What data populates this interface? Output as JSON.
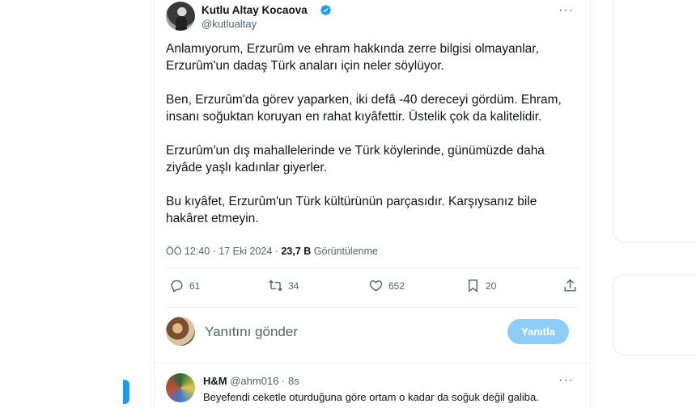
{
  "tweet": {
    "author_name": "Kutlu Altay Kocaova",
    "author_handle": "@kutlualtay",
    "more_label": "···",
    "paragraphs": [
      "Anlamıyorum, Erzurûm ve ehram hakkında zerre bilgisi olmayanlar, Erzurûm'un dadaş Türk anaları için neler söylüyor.",
      "Ben, Erzurûm'da görev yaparken, iki defâ -40 dereceyi gördüm. Ehram, insanı soğuktan koruyan en rahat kıyâfettir. Üstelik çok da kalitelidir.",
      "Erzurûm'un dış mahallelerinde ve Türk köylerinde, günümüzde daha ziyâde yaşlı kadınlar giyerler.",
      "Bu kıyâfet, Erzurûm'un Türk kültürünün parçasıdır. Karşıysanız bile hakâret etmeyin."
    ],
    "time": "ÖÖ 12:40 · 17 Eki 2024 · ",
    "views_count": "23,7 B",
    "views_label": " Görüntülenme"
  },
  "actions": {
    "replies": "61",
    "retweets": "34",
    "likes": "652",
    "bookmarks": "20"
  },
  "reply_composer": {
    "placeholder": "Yanıtını gönder",
    "button_label": "Yanıtla"
  },
  "reply": {
    "name": "H&M",
    "handle": "@ahm016",
    "time": "8s",
    "text": "Beyefendi ceketle oturduğuna göre ortam o kadar da soğuk değil galiba.",
    "more_label": "···"
  },
  "colors": {
    "accent": "#1d9bf0",
    "reply_button_disabled": "#8ecdf7",
    "muted_text": "#536471"
  }
}
